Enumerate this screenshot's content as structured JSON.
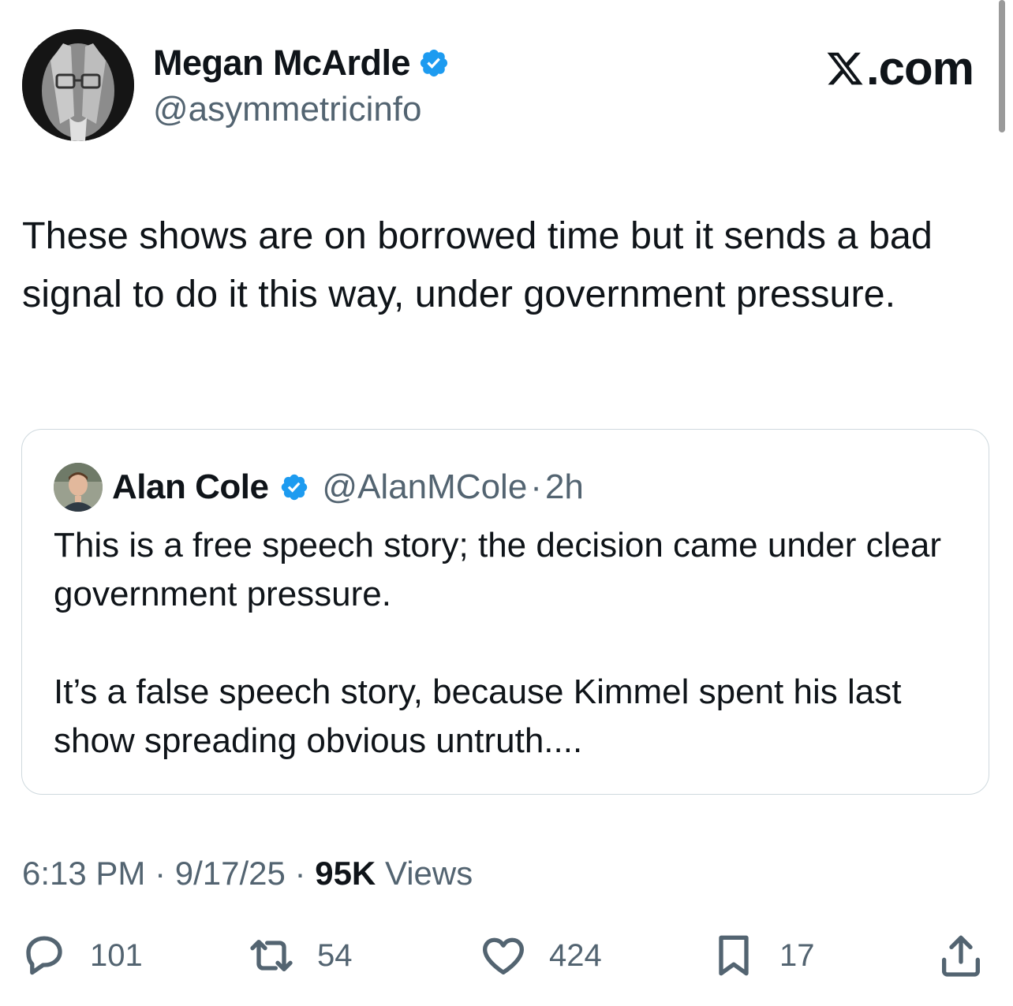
{
  "author": {
    "name": "Megan McArdle",
    "handle": "@asymmetricinfo",
    "verified_icon": "verified-badge-icon",
    "avatar_icon": "avatar-photo"
  },
  "brand": {
    "label": ".com",
    "icon": "x-logo-icon"
  },
  "tweet": {
    "text": "These shows are on borrowed time but it sends a bad signal to do it this way, under government pressure."
  },
  "quote": {
    "name": "Alan Cole",
    "handle": "@AlanMCole",
    "separator": "·",
    "time": "2h",
    "text": "This is a free speech story; the decision came under clear government pressure.\n\nIt’s a false speech story, because Kimmel spent his last show spreading obvious untruth...."
  },
  "meta": {
    "time": "6:13 PM",
    "sep1": " · ",
    "date": "9/17/25",
    "sep2": " · ",
    "views_count": "95K",
    "views_label": " Views"
  },
  "actions": {
    "replies": "101",
    "reposts": "54",
    "likes": "424",
    "bookmarks": "17"
  },
  "colors": {
    "text": "#0f1419",
    "secondary": "#536471",
    "verified": "#1d9bf0",
    "border": "#cfd9de"
  }
}
